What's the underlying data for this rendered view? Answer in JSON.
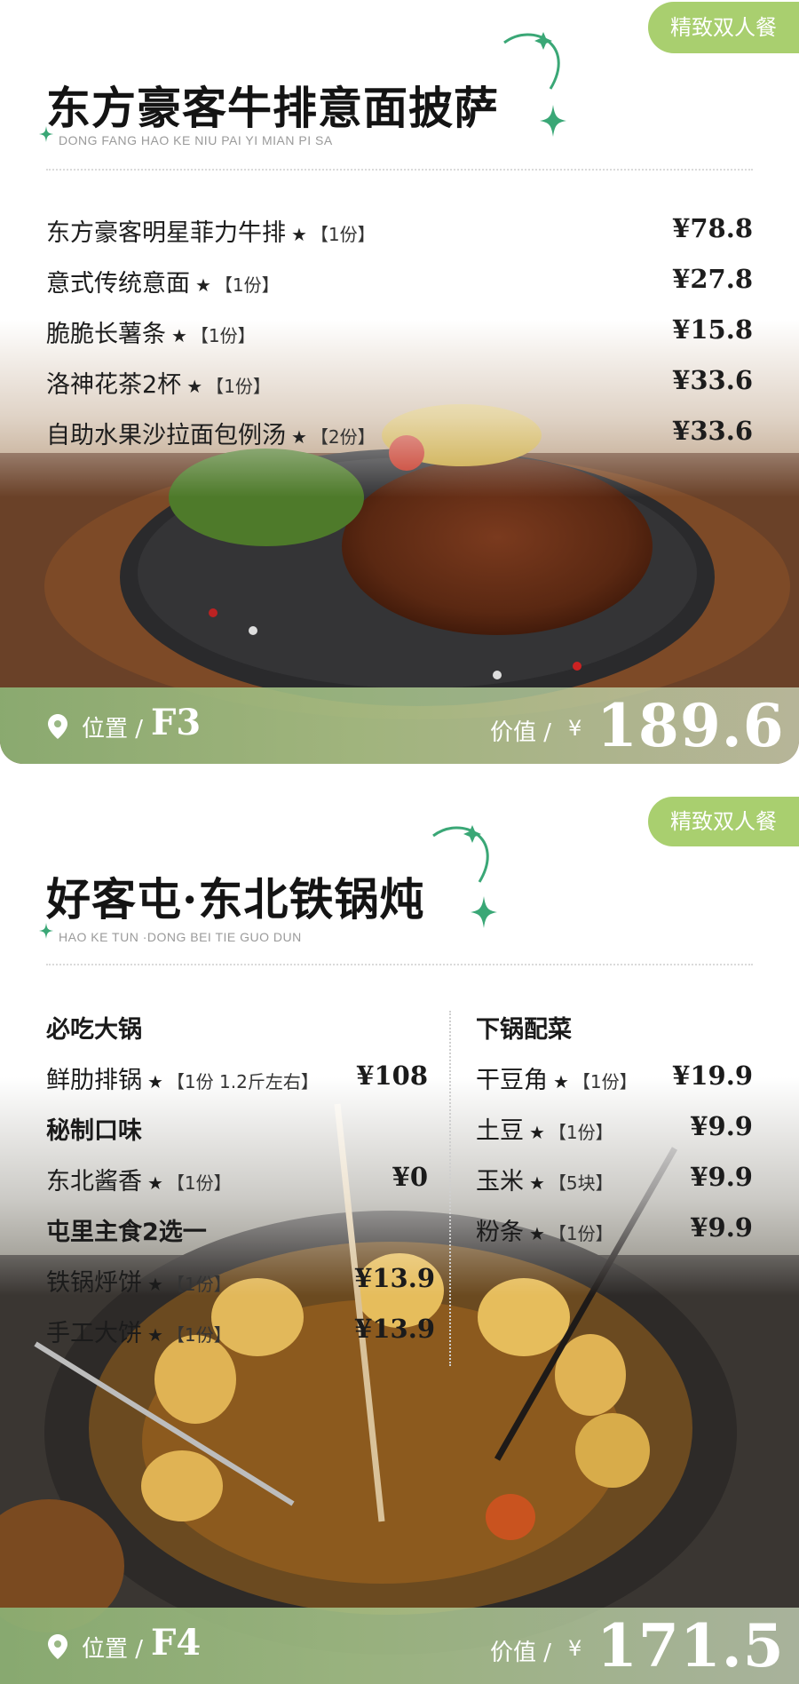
{
  "card1": {
    "badge": "精致双人餐",
    "title": "东方豪客牛排意面披萨",
    "subtitle": "DONG FANG HAO KE NIU PAI YI MIAN PI SA",
    "items": [
      {
        "name": "东方豪客明星菲力牛排",
        "star": "★",
        "qty": "【1份】",
        "price": "¥78.8"
      },
      {
        "name": "意式传统意面",
        "star": "★",
        "qty": "【1份】",
        "price": "¥27.8"
      },
      {
        "name": "脆脆长薯条",
        "star": "★",
        "qty": "【1份】",
        "price": "¥15.8"
      },
      {
        "name": "洛神花茶2杯",
        "star": "★",
        "qty": "【1份】",
        "price": "¥33.6"
      },
      {
        "name": "自助水果沙拉面包例汤",
        "star": "★",
        "qty": "【2份】",
        "price": "¥33.6"
      }
    ],
    "location_label": "位置 /",
    "location": "F3",
    "value_label": "价值 /",
    "currency": "¥",
    "total": "189.6"
  },
  "card2": {
    "badge": "精致双人餐",
    "title": "好客屯·东北铁锅炖",
    "subtitle": "HAO KE TUN  ·DONG BEI TIE GUO DUN",
    "left": [
      {
        "type": "heading",
        "name": "必吃大锅"
      },
      {
        "type": "item",
        "name": "鲜肋排锅",
        "star": "★",
        "qty": "【1份 1.2斤左右】",
        "price": "¥108"
      },
      {
        "type": "heading",
        "name": "秘制口味"
      },
      {
        "type": "item",
        "name": "东北酱香",
        "star": "★",
        "qty": "【1份】",
        "price": "¥0"
      },
      {
        "type": "heading",
        "name": "屯里主食2选一"
      },
      {
        "type": "item",
        "name": "铁锅烀饼",
        "star": "★",
        "qty": "【1份】",
        "price": "¥13.9"
      },
      {
        "type": "item",
        "name": "手工大饼",
        "star": "★",
        "qty": "【1份】",
        "price": "¥13.9"
      }
    ],
    "right": [
      {
        "type": "heading",
        "name": "下锅配菜"
      },
      {
        "type": "item",
        "name": "干豆角",
        "star": "★",
        "qty": "【1份】",
        "price": "¥19.9"
      },
      {
        "type": "item",
        "name": "土豆",
        "star": "★",
        "qty": "【1份】",
        "price": "¥9.9"
      },
      {
        "type": "item",
        "name": "玉米",
        "star": "★",
        "qty": "【5块】",
        "price": "¥9.9"
      },
      {
        "type": "item",
        "name": "粉条",
        "star": "★",
        "qty": "【1份】",
        "price": "¥9.9"
      }
    ],
    "location_label": "位置 /",
    "location": "F4",
    "value_label": "价值 /",
    "currency": "¥",
    "total": "171.5"
  },
  "colors": {
    "accent_green": "#a9cf6f",
    "sparkle": "#3aa776"
  }
}
